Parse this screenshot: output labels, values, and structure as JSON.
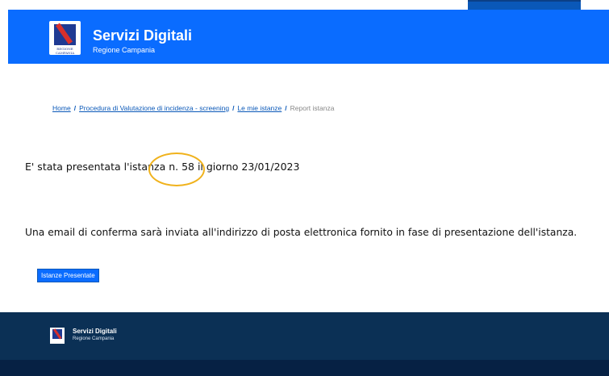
{
  "header": {
    "title": "Servizi Digitali",
    "subtitle": "Regione Campania",
    "logo_caption": "REGIONE CAMPANIA"
  },
  "breadcrumb": {
    "items": [
      "Home",
      "Procedura di Valutazione di incidenza - screening",
      "Le mie istanze"
    ],
    "separator": "/",
    "current": "Report istanza"
  },
  "main": {
    "submitted_message": "E' stata presentata l'istanza n. 58 il giorno 23/01/2023",
    "email_message": "Una email di conferma sarà inviata all'indirizzo di posta elettronica fornito in fase di presentazione dell'istanza.",
    "button_label": "Istanze Presentate"
  },
  "footer": {
    "title": "Servizi Digitali",
    "subtitle": "Regione Campania"
  },
  "colors": {
    "header_blue": "#0a6cff",
    "footer_navy": "#0b3055",
    "highlight_circle": "#f0b21c"
  }
}
